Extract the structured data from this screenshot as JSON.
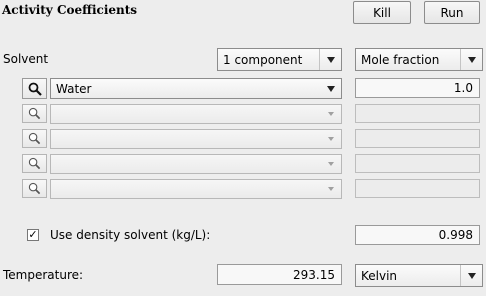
{
  "header": {
    "title": "Activity Coefficients",
    "kill_label": "Kill",
    "run_label": "Run"
  },
  "solvent": {
    "label": "Solvent",
    "components_value": "1 component",
    "units_value": "Mole fraction",
    "rows": [
      {
        "name": "Water",
        "amount": "1.0",
        "enabled": true
      },
      {
        "name": "",
        "amount": "",
        "enabled": false
      },
      {
        "name": "",
        "amount": "",
        "enabled": false
      },
      {
        "name": "",
        "amount": "",
        "enabled": false
      },
      {
        "name": "",
        "amount": "",
        "enabled": false
      }
    ]
  },
  "density": {
    "checked": true,
    "label": "Use density solvent (kg/L):",
    "value": "0.998"
  },
  "temperature": {
    "label": "Temperature:",
    "value": "293.15",
    "unit": "Kelvin"
  }
}
